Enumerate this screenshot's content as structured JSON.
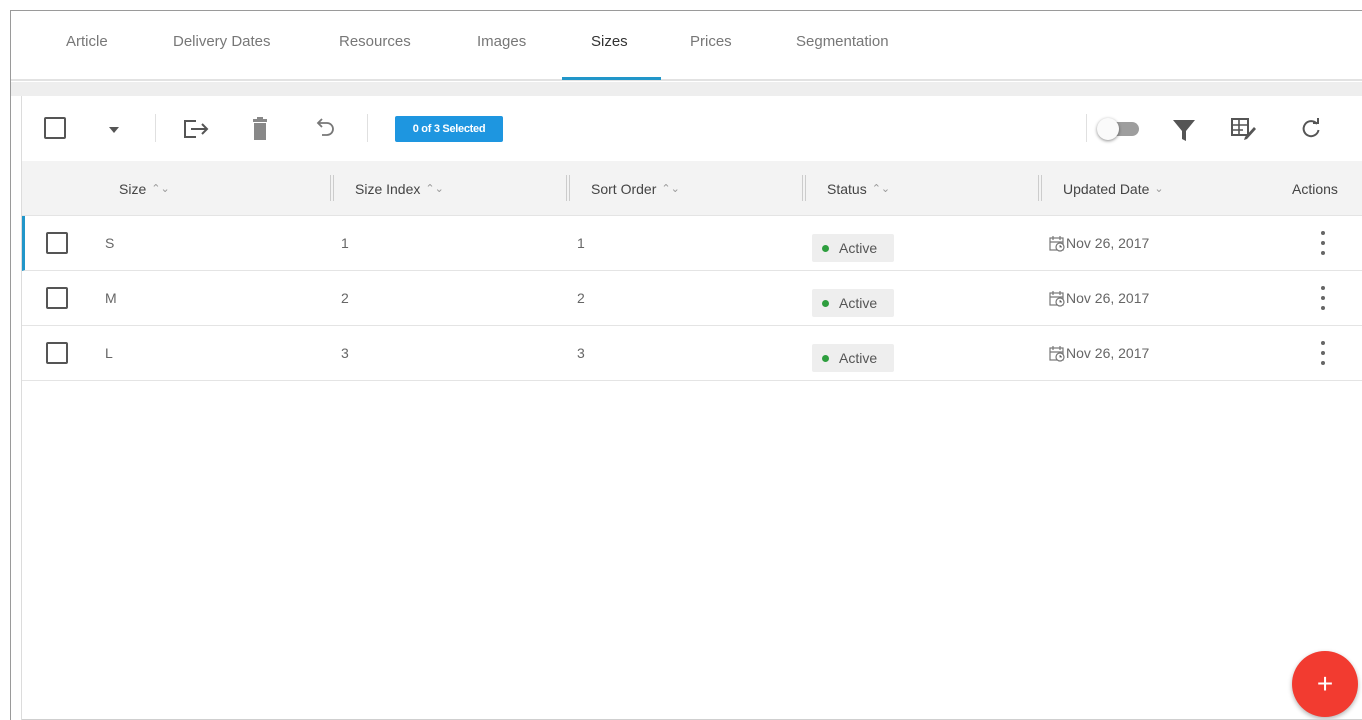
{
  "tabs": [
    {
      "label": "Article"
    },
    {
      "label": "Delivery Dates"
    },
    {
      "label": "Resources"
    },
    {
      "label": "Images"
    },
    {
      "label": "Sizes"
    },
    {
      "label": "Prices"
    },
    {
      "label": "Segmentation"
    }
  ],
  "active_tab": "Sizes",
  "toolbar": {
    "selected_badge": "0 of 3 Selected",
    "icons": [
      "select-all-checkbox",
      "dropdown-caret-icon",
      "export-icon",
      "delete-icon",
      "undo-icon",
      "toggle-switch",
      "filter-icon",
      "edit-columns-icon",
      "refresh-icon"
    ]
  },
  "columns": [
    {
      "label": "Size",
      "sort": "⌃⌄"
    },
    {
      "label": "Size Index",
      "sort": "⌃⌄"
    },
    {
      "label": "Sort Order",
      "sort": "⌃⌄"
    },
    {
      "label": "Status",
      "sort": "⌃⌄"
    },
    {
      "label": "Updated Date",
      "sort": "⌄"
    },
    {
      "label": "Actions"
    }
  ],
  "rows": [
    {
      "size": "S",
      "size_index": "1",
      "sort_order": "1",
      "status": "Active",
      "updated": "Nov 26, 2017"
    },
    {
      "size": "M",
      "size_index": "2",
      "sort_order": "2",
      "status": "Active",
      "updated": "Nov 26, 2017"
    },
    {
      "size": "L",
      "size_index": "3",
      "sort_order": "3",
      "status": "Active",
      "updated": "Nov 26, 2017"
    }
  ],
  "fab": {
    "label": "+"
  },
  "colors": {
    "accent": "#2196c9",
    "badge": "#1e96e0",
    "fab": "#f23b30",
    "status_dot": "#2e9e3e"
  }
}
